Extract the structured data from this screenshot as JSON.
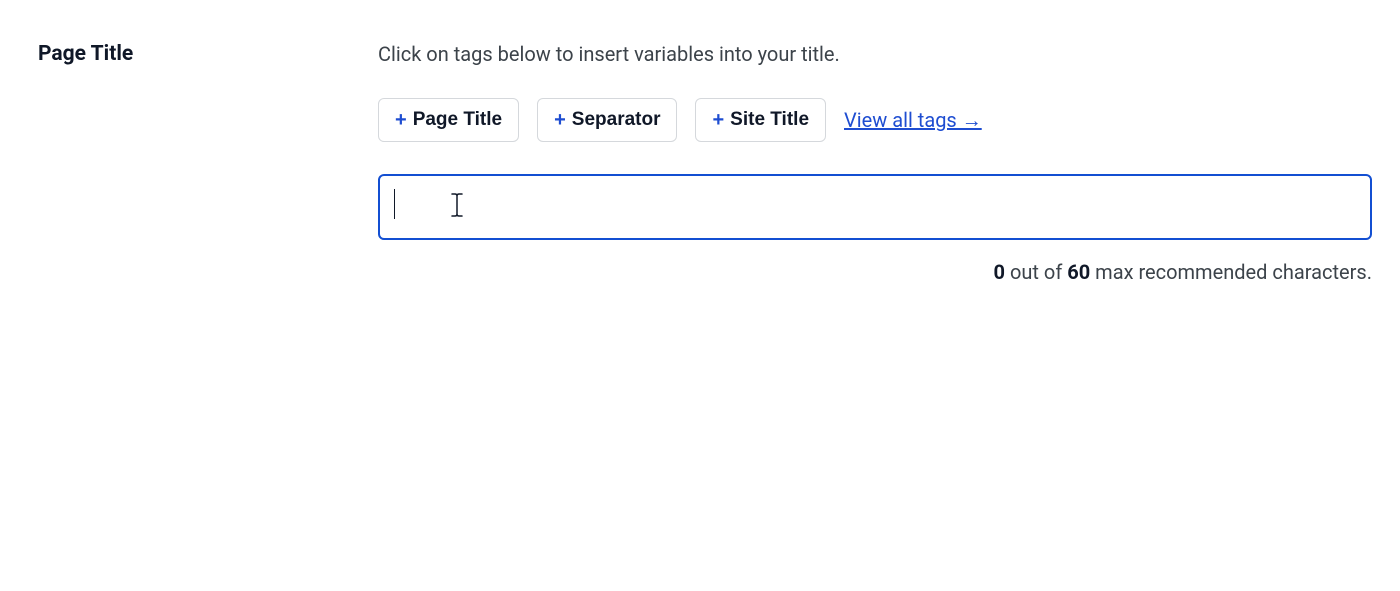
{
  "section": {
    "label": "Page Title",
    "helper": "Click on tags below to insert variables into your title."
  },
  "tags": [
    {
      "label": "Page Title"
    },
    {
      "label": "Separator"
    },
    {
      "label": "Site Title"
    }
  ],
  "view_all": "View all tags →",
  "input": {
    "value": ""
  },
  "counter": {
    "current": "0",
    "sep1": " out of ",
    "max": "60",
    "suffix": " max recommended characters."
  }
}
